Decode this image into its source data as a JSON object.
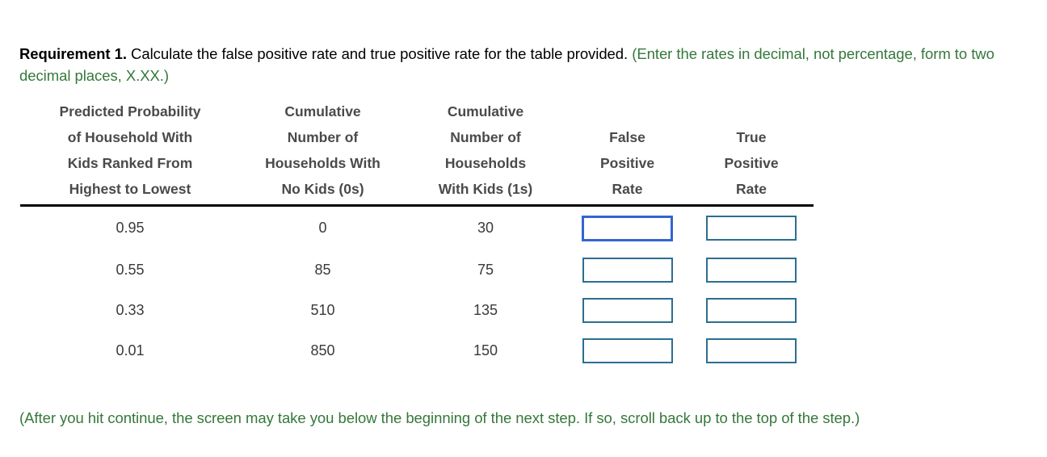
{
  "prompt": {
    "requirement_label": "Requirement 1.",
    "instruction": " Calculate the false positive rate and true positive rate for the table provided. ",
    "green_hint": "(Enter the rates in decimal, not percentage, form to two decimal places, X.XX.)"
  },
  "table": {
    "columns": [
      {
        "id": "predicted-probability",
        "header_lines": [
          "Predicted Probability",
          "of Household With",
          "Kids Ranked From",
          "Highest to Lowest"
        ]
      },
      {
        "id": "cumulative-no-kids",
        "header_lines": [
          "Cumulative",
          "Number of",
          "Households With",
          "No Kids (0s)"
        ]
      },
      {
        "id": "cumulative-with-kids",
        "header_lines": [
          "Cumulative",
          "Number of",
          "Households",
          "With Kids (1s)"
        ]
      },
      {
        "id": "false-positive-rate",
        "header_lines": [
          "",
          "False",
          "Positive",
          "Rate"
        ]
      },
      {
        "id": "true-positive-rate",
        "header_lines": [
          "",
          "True",
          "Positive",
          "Rate"
        ]
      }
    ],
    "rows": [
      {
        "predicted_probability": "0.95",
        "cumulative_no_kids": "0",
        "cumulative_with_kids": "30",
        "false_positive_rate": "",
        "true_positive_rate": ""
      },
      {
        "predicted_probability": "0.55",
        "cumulative_no_kids": "85",
        "cumulative_with_kids": "75",
        "false_positive_rate": "",
        "true_positive_rate": ""
      },
      {
        "predicted_probability": "0.33",
        "cumulative_no_kids": "510",
        "cumulative_with_kids": "135",
        "false_positive_rate": "",
        "true_positive_rate": ""
      },
      {
        "predicted_probability": "0.01",
        "cumulative_no_kids": "850",
        "cumulative_with_kids": "150",
        "false_positive_rate": "",
        "true_positive_rate": ""
      }
    ],
    "input_placeholder": ""
  },
  "footer": {
    "note": "(After you hit continue, the screen may take you below the beginning of the next step. If so, scroll back up to the top of the step.)"
  },
  "colors": {
    "focused_input_border": "#3366cc",
    "input_border": "#2c6e91",
    "green_text": "#35783a",
    "header_text": "#4a4a4a",
    "data_text": "#3a3a3a",
    "rule": "#000000",
    "background": "#ffffff"
  }
}
